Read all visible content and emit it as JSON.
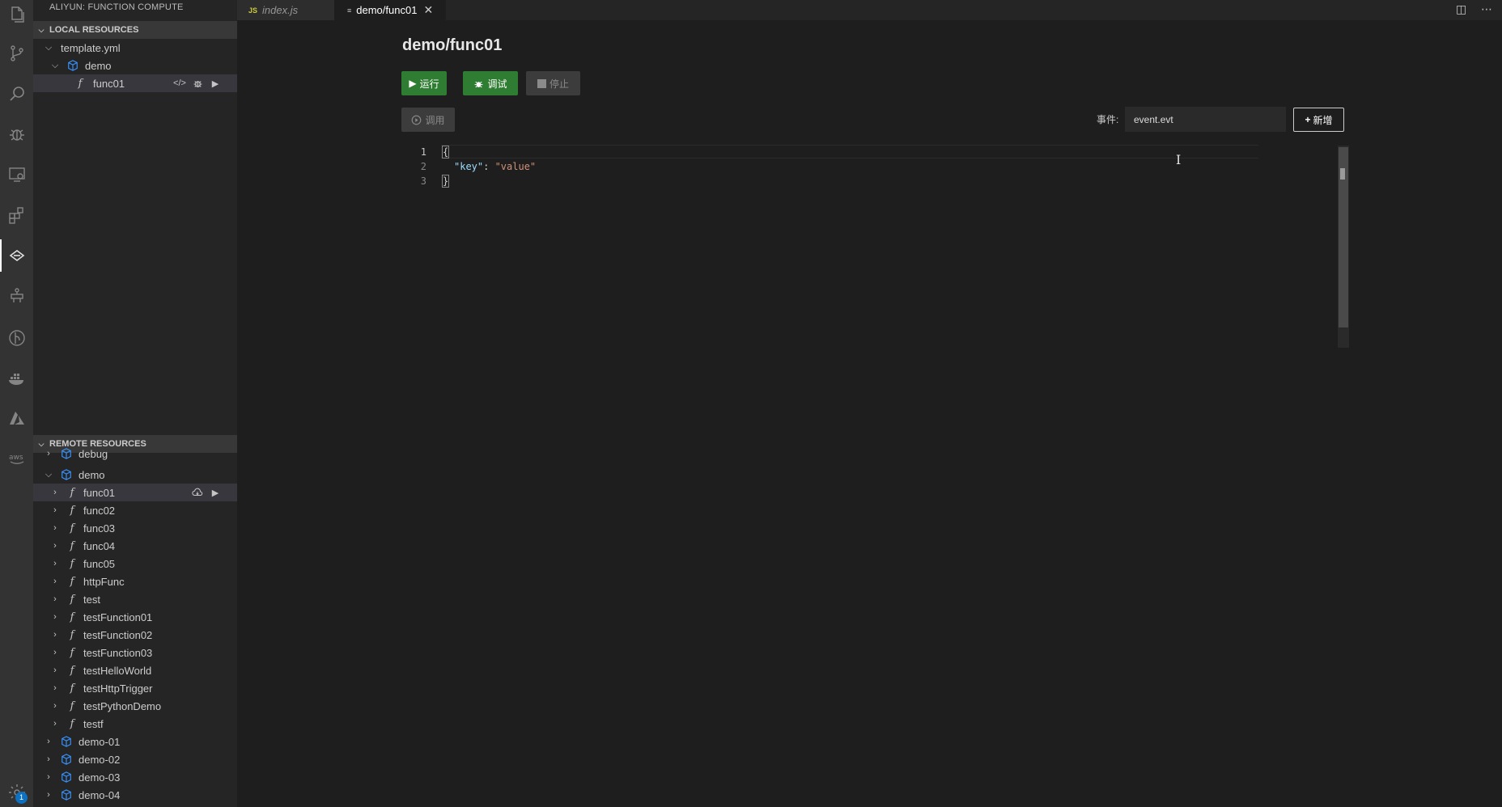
{
  "sidebar": {
    "title": "ALIYUN: FUNCTION COMPUTE",
    "local": {
      "header": "LOCAL RESOURCES",
      "template": "template.yml",
      "service": "demo",
      "function": "func01"
    },
    "remote": {
      "header": "REMOTE RESOURCES",
      "items": [
        {
          "label": "debug",
          "kind": "service",
          "expanded": false,
          "level": 1
        },
        {
          "label": "demo",
          "kind": "service",
          "expanded": true,
          "level": 1
        },
        {
          "label": "func01",
          "kind": "function",
          "level": 2,
          "selected": true
        },
        {
          "label": "func02",
          "kind": "function",
          "level": 2
        },
        {
          "label": "func03",
          "kind": "function",
          "level": 2
        },
        {
          "label": "func04",
          "kind": "function",
          "level": 2
        },
        {
          "label": "func05",
          "kind": "function",
          "level": 2
        },
        {
          "label": "httpFunc",
          "kind": "function",
          "level": 2
        },
        {
          "label": "test",
          "kind": "function",
          "level": 2
        },
        {
          "label": "testFunction01",
          "kind": "function",
          "level": 2
        },
        {
          "label": "testFunction02",
          "kind": "function",
          "level": 2
        },
        {
          "label": "testFunction03",
          "kind": "function",
          "level": 2
        },
        {
          "label": "testHelloWorld",
          "kind": "function",
          "level": 2
        },
        {
          "label": "testHttpTrigger",
          "kind": "function",
          "level": 2
        },
        {
          "label": "testPythonDemo",
          "kind": "function",
          "level": 2
        },
        {
          "label": "testf",
          "kind": "function",
          "level": 2
        },
        {
          "label": "demo-01",
          "kind": "service",
          "expanded": false,
          "level": 1
        },
        {
          "label": "demo-02",
          "kind": "service",
          "expanded": false,
          "level": 1
        },
        {
          "label": "demo-03",
          "kind": "service",
          "expanded": false,
          "level": 1
        },
        {
          "label": "demo-04",
          "kind": "service",
          "expanded": false,
          "level": 1
        }
      ]
    }
  },
  "tabs": [
    {
      "label": "index.js",
      "icon": "JS",
      "active": false
    },
    {
      "label": "demo/func01",
      "icon": "≡",
      "active": true
    }
  ],
  "editor": {
    "title": "demo/func01",
    "buttons": {
      "run": "运行",
      "debug": "调试",
      "stop": "停止",
      "invoke": "调用",
      "new": "新增"
    },
    "event_label": "事件:",
    "event_value": "event.evt",
    "code_lines": [
      "1",
      "2",
      "3"
    ],
    "code": {
      "open": "{",
      "key": "\"key\"",
      "colon": ": ",
      "value": "\"value\"",
      "close": "}"
    }
  },
  "activity_badge": "1",
  "colors": {
    "accent_green": "#2f7d32",
    "badge_blue": "#0e70c0"
  }
}
